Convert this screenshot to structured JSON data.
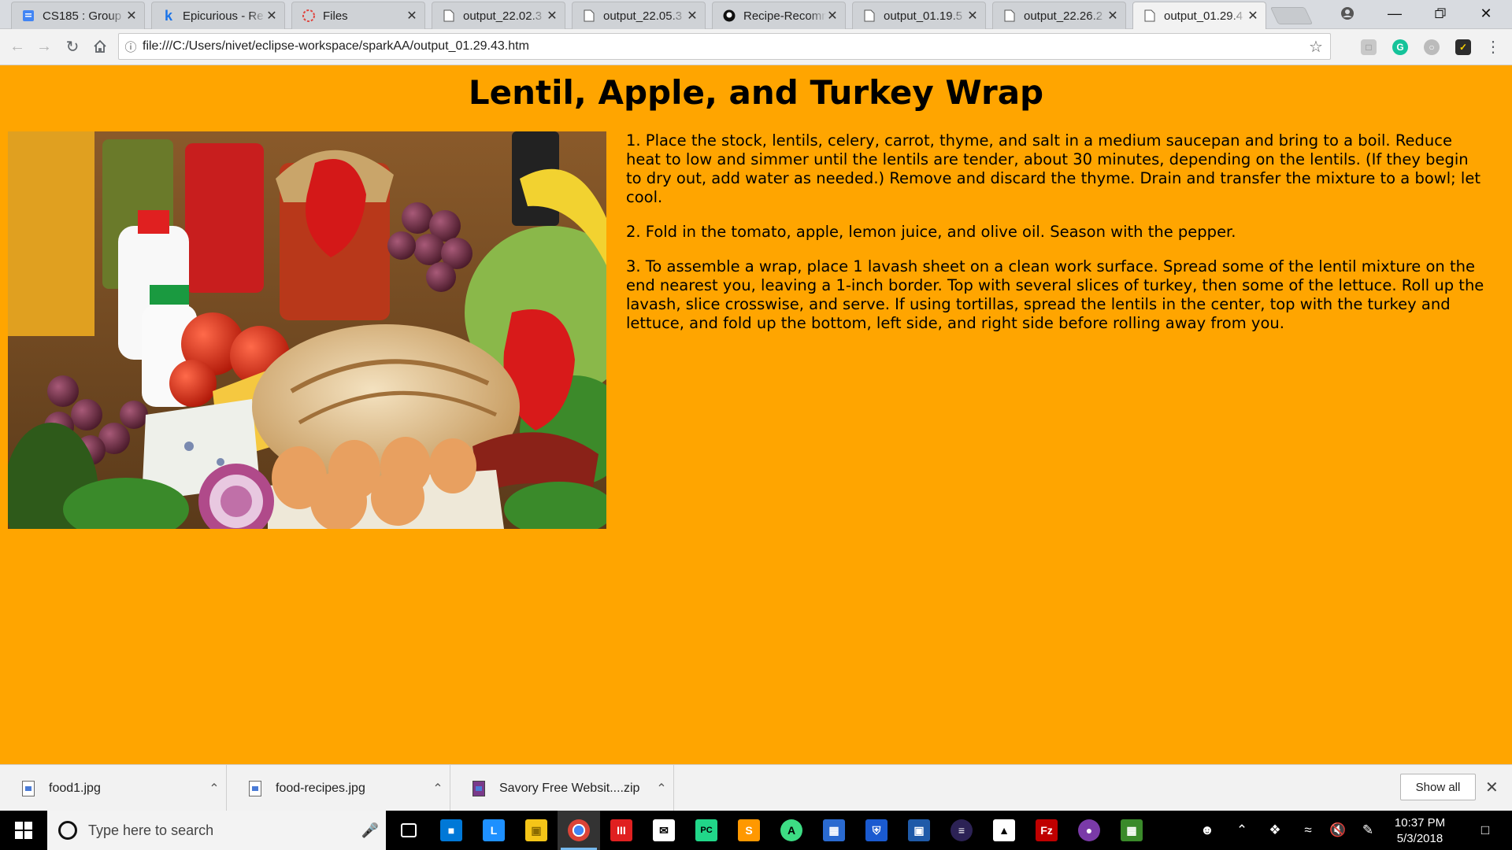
{
  "browser": {
    "tabs": [
      {
        "title": "CS185 : Group",
        "icon": "docs-icon"
      },
      {
        "title": "Epicurious - Re",
        "icon": "k-icon"
      },
      {
        "title": "Files",
        "icon": "files-icon"
      },
      {
        "title": "output_22.02.3",
        "icon": "page-icon"
      },
      {
        "title": "output_22.05.3",
        "icon": "page-icon"
      },
      {
        "title": "Recipe-Recomm",
        "icon": "github-icon"
      },
      {
        "title": "output_01.19.5",
        "icon": "page-icon"
      },
      {
        "title": "output_22.26.2",
        "icon": "page-icon"
      },
      {
        "title": "output_01.29.4",
        "icon": "page-icon"
      }
    ],
    "active_tab_index": 8,
    "address_bar": {
      "url": "file:///C:/Users/nivet/eclipse-workspace/sparkAA/output_01.29.43.htm"
    }
  },
  "page": {
    "title": "Lentil, Apple, and Turkey Wrap",
    "image_alt_icon": "groceries-photo",
    "steps": [
      "1. Place the stock, lentils, celery, carrot, thyme, and salt in a medium saucepan and bring to a boil. Reduce heat to low and simmer until the lentils are tender, about 30 minutes, depending on the lentils. (If they begin to dry out, add water as needed.) Remove and discard the thyme. Drain and transfer the mixture to a bowl; let cool.",
      "2. Fold in the tomato, apple, lemon juice, and olive oil. Season with the pepper.",
      "3. To assemble a wrap, place 1 lavash sheet on a clean work surface. Spread some of the lentil mixture on the end nearest you, leaving a 1-inch border. Top with several slices of turkey, then some of the lettuce. Roll up the lavash, slice crosswise, and serve. If using tortillas, spread the lentils in the center, top with the turkey and lettuce, and fold up the bottom, left side, and right side before rolling away from you."
    ],
    "background_color": "#ffa500"
  },
  "downloads": {
    "items": [
      {
        "name": "food1.jpg"
      },
      {
        "name": "food-recipes.jpg"
      },
      {
        "name": "Savory Free Websit....zip"
      }
    ],
    "show_all_label": "Show all"
  },
  "taskbar": {
    "search_placeholder": "Type here to search",
    "clock_time": "10:37 PM",
    "clock_date": "5/3/2018"
  }
}
